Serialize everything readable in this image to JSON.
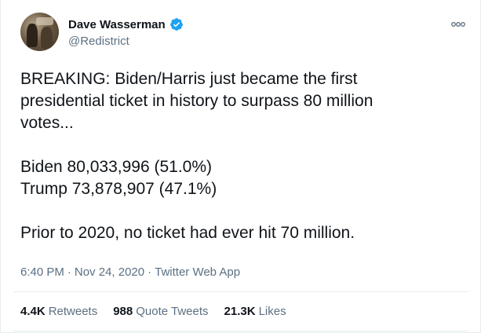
{
  "tweet": {
    "display_name": "Dave Wasserman",
    "handle": "@Redistrict",
    "verified": true,
    "more_icon": "more-dots-icon",
    "text_lines": [
      "BREAKING: Biden/Harris just became the first",
      "presidential ticket in history to surpass 80 million",
      "votes..."
    ],
    "results": [
      "Biden 80,033,996 (51.0%)",
      "Trump 73,878,907 (47.1%)"
    ],
    "closing": "Prior to 2020, no ticket had ever hit 70 million.",
    "time": "6:40 PM",
    "date": "Nov 24, 2020",
    "source": "Twitter Web App",
    "separator": "·"
  },
  "stats": {
    "retweets_count": "4.4K",
    "retweets_label": "Retweets",
    "quotes_count": "988",
    "quotes_label": "Quote Tweets",
    "likes_count": "21.3K",
    "likes_label": "Likes"
  },
  "colors": {
    "text": "#0f1419",
    "secondary": "#5b7083",
    "verified": "#1da1f2",
    "divider": "#e6ecf0"
  }
}
